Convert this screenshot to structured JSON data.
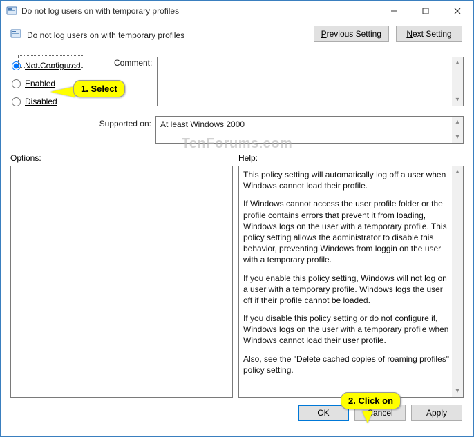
{
  "titlebar": {
    "title": "Do not log users on with temporary profiles"
  },
  "header": {
    "title": "Do not log users on with temporary profiles"
  },
  "nav": {
    "prev_p": "P",
    "prev_rest": "revious Setting",
    "next_n": "N",
    "next_rest": "ext Setting"
  },
  "radios": {
    "not_configured": "Not Configured",
    "enabled": "Enabled",
    "disabled": "Disabled",
    "selected": "not_configured"
  },
  "labels": {
    "comment": "Comment:",
    "supported": "Supported on:",
    "options": "Options:",
    "help": "Help:"
  },
  "supported_on": "At least Windows 2000",
  "comment_value": "",
  "options_value": "",
  "help_paragraphs": [
    "This policy setting will automatically log off a user when Windows cannot load their profile.",
    "If Windows cannot access the user profile folder or the profile contains errors that prevent it from loading, Windows logs on the user with a temporary profile. This policy setting allows the administrator to disable this behavior, preventing Windows from loggin on the user with a temporary profile.",
    "If you enable this policy setting, Windows will not log on a user with a temporary profile. Windows logs the user off if their profile cannot be loaded.",
    "If you disable this policy setting or do not configure it, Windows logs on the user with a temporary profile when Windows cannot load their user profile.",
    "Also, see the \"Delete cached copies of roaming profiles\" policy setting."
  ],
  "buttons": {
    "ok": "OK",
    "cancel": "Cancel",
    "apply": "Apply"
  },
  "annotations": {
    "select": "1. Select",
    "clickon": "2. Click on"
  },
  "watermark": "TenForums.com"
}
